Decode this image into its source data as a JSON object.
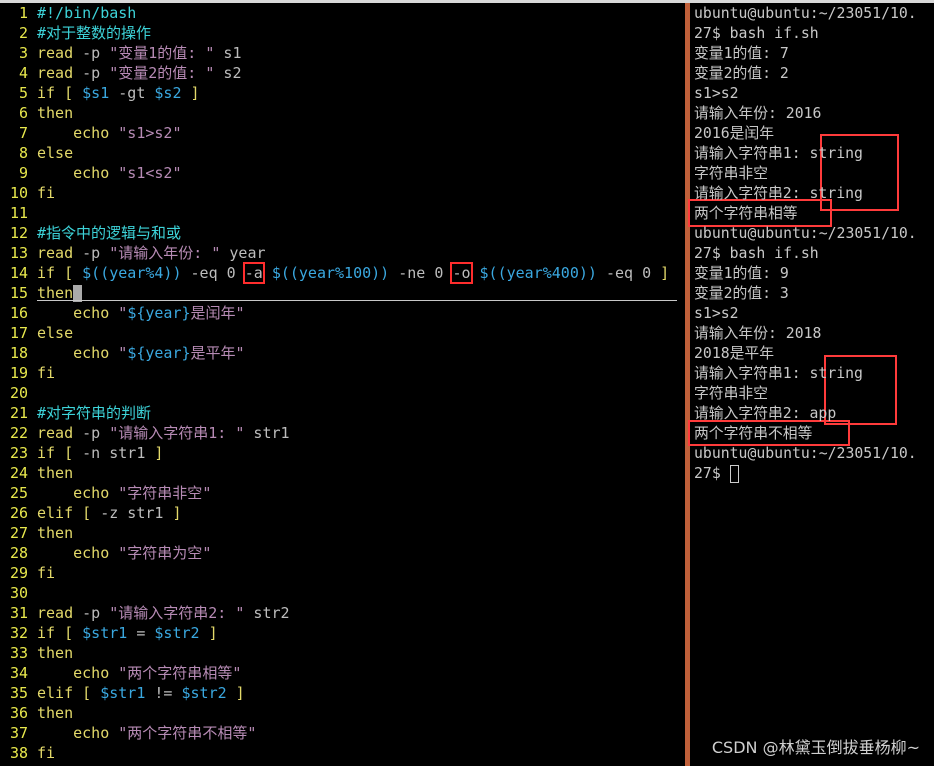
{
  "editor": {
    "lines": [
      [
        [
          "#!/bin/bash",
          "c"
        ]
      ],
      [
        [
          "#对于整数的操作",
          "c"
        ]
      ],
      [
        [
          "read",
          "k"
        ],
        [
          " -p ",
          "p"
        ],
        [
          "\"变量1的值: \"",
          "s"
        ],
        [
          " s1",
          "p"
        ]
      ],
      [
        [
          "read",
          "k"
        ],
        [
          " -p ",
          "p"
        ],
        [
          "\"变量2的值: \"",
          "s"
        ],
        [
          " s2",
          "p"
        ]
      ],
      [
        [
          "if",
          "k"
        ],
        [
          " [ ",
          "k"
        ],
        [
          "$s1",
          "v"
        ],
        [
          " -gt ",
          "p"
        ],
        [
          "$s2",
          "v"
        ],
        [
          " ]",
          "k"
        ]
      ],
      [
        [
          "then",
          "k"
        ]
      ],
      [
        [
          "    echo ",
          "k"
        ],
        [
          "\"s1>s2\"",
          "s"
        ]
      ],
      [
        [
          "else",
          "k"
        ]
      ],
      [
        [
          "    echo ",
          "k"
        ],
        [
          "\"s1<s2\"",
          "s"
        ]
      ],
      [
        [
          "fi",
          "k"
        ]
      ],
      [],
      [
        [
          "#指令中的逻辑与和或",
          "c"
        ]
      ],
      [
        [
          "read",
          "k"
        ],
        [
          " -p ",
          "p"
        ],
        [
          "\"请输入年份: \"",
          "s"
        ],
        [
          " year",
          "p"
        ]
      ],
      [
        [
          "if",
          "k"
        ],
        [
          " [ ",
          "k"
        ],
        [
          "$((year%4))",
          "v"
        ],
        [
          " -eq 0 ",
          "p"
        ],
        [
          "-a",
          "p",
          "box"
        ],
        [
          " ",
          "p"
        ],
        [
          "$((year%100))",
          "v"
        ],
        [
          " -ne 0 ",
          "p"
        ],
        [
          "-o",
          "p",
          "box"
        ],
        [
          " ",
          "p"
        ],
        [
          "$((year%400))",
          "v"
        ],
        [
          " -eq 0 ",
          "p"
        ],
        [
          "]",
          "k"
        ]
      ],
      [
        [
          "then",
          "k"
        ]
      ],
      [
        [
          "    echo ",
          "k"
        ],
        [
          "\"",
          "s"
        ],
        [
          "${year}",
          "v"
        ],
        [
          "是闰年\"",
          "s"
        ]
      ],
      [
        [
          "else",
          "k"
        ]
      ],
      [
        [
          "    echo ",
          "k"
        ],
        [
          "\"",
          "s"
        ],
        [
          "${year}",
          "v"
        ],
        [
          "是平年\"",
          "s"
        ]
      ],
      [
        [
          "fi",
          "k"
        ]
      ],
      [],
      [
        [
          "#对字符串的判断",
          "c"
        ]
      ],
      [
        [
          "read",
          "k"
        ],
        [
          " -p ",
          "p"
        ],
        [
          "\"请输入字符串1: \"",
          "s"
        ],
        [
          " str1",
          "p"
        ]
      ],
      [
        [
          "if",
          "k"
        ],
        [
          " [ ",
          "k"
        ],
        [
          "-n str1",
          "p"
        ],
        [
          " ]",
          "k"
        ]
      ],
      [
        [
          "then",
          "k"
        ]
      ],
      [
        [
          "    echo ",
          "k"
        ],
        [
          "\"字符串非空\"",
          "s"
        ]
      ],
      [
        [
          "elif",
          "k"
        ],
        [
          " [ ",
          "k"
        ],
        [
          "-z str1",
          "p"
        ],
        [
          " ]",
          "k"
        ]
      ],
      [
        [
          "then",
          "k"
        ]
      ],
      [
        [
          "    echo ",
          "k"
        ],
        [
          "\"字符串为空\"",
          "s"
        ]
      ],
      [
        [
          "fi",
          "k"
        ]
      ],
      [],
      [
        [
          "read",
          "k"
        ],
        [
          " -p ",
          "p"
        ],
        [
          "\"请输入字符串2: \"",
          "s"
        ],
        [
          " str2",
          "p"
        ]
      ],
      [
        [
          "if",
          "k"
        ],
        [
          " [ ",
          "k"
        ],
        [
          "$str1",
          "v"
        ],
        [
          " = ",
          "p"
        ],
        [
          "$str2",
          "v"
        ],
        [
          " ]",
          "k"
        ]
      ],
      [
        [
          "then",
          "k"
        ]
      ],
      [
        [
          "    echo ",
          "k"
        ],
        [
          "\"两个字符串相等\"",
          "s"
        ]
      ],
      [
        [
          "elif",
          "k"
        ],
        [
          " [ ",
          "k"
        ],
        [
          "$str1",
          "v"
        ],
        [
          " != ",
          "p"
        ],
        [
          "$str2",
          "v"
        ],
        [
          " ]",
          "k"
        ]
      ],
      [
        [
          "then",
          "k"
        ]
      ],
      [
        [
          "    echo ",
          "k"
        ],
        [
          "\"两个字符串不相等\"",
          "s"
        ]
      ],
      [
        [
          "fi",
          "k"
        ]
      ]
    ],
    "cursor_line": 15
  },
  "terminal": {
    "lines": [
      "ubuntu@ubuntu:~/23051/10.",
      "27$ bash if.sh",
      "变量1的值: 7",
      "变量2的值: 2",
      "s1>s2",
      "请输入年份: 2016",
      "2016是闰年",
      "请输入字符串1: string",
      "字符串非空",
      "请输入字符串2: string",
      "两个字符串相等",
      "ubuntu@ubuntu:~/23051/10.",
      "27$ bash if.sh",
      "变量1的值: 9",
      "变量2的值: 3",
      "s1>s2",
      "请输入年份: 2018",
      "2018是平年",
      "请输入字符串1: string",
      "字符串非空",
      "请输入字符串2: app",
      "两个字符串不相等",
      "ubuntu@ubuntu:~/23051/10.",
      "27$ "
    ]
  },
  "watermark": "CSDN @林黛玉倒拔垂杨柳~",
  "colors": {
    "line_number": "#e8e84c",
    "keyword": "#e3d96a",
    "string": "#b78bb5",
    "comment": "#3dd3d9",
    "variable": "#3aa8e0",
    "highlight_box": "#ff2d2d",
    "divider": "#c0603a"
  }
}
